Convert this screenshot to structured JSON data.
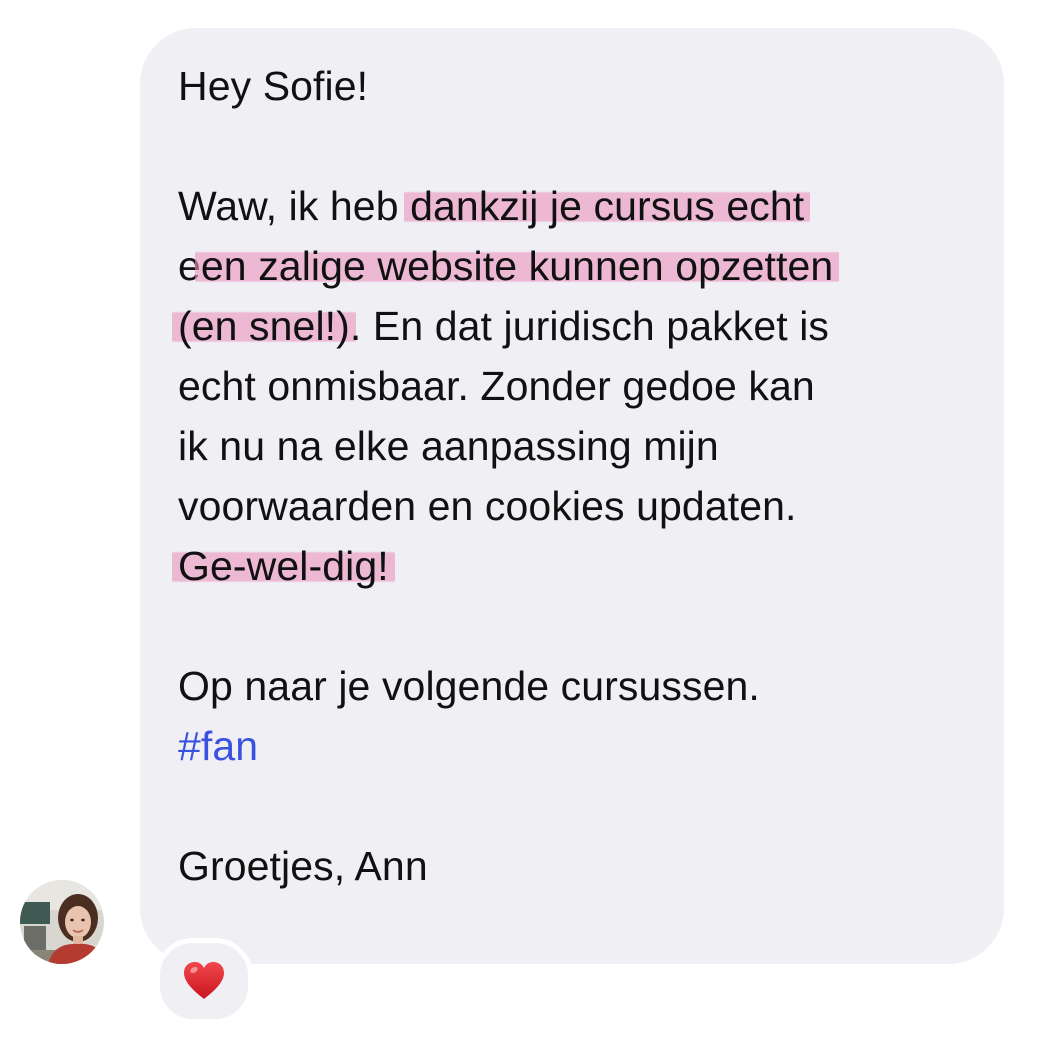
{
  "message": {
    "greeting": "Hey Sofie!",
    "p1_l1_pre": "Waw, ik heb ",
    "p1_l1_hl": "dankzij je cursus echt",
    "p1_l2_pre": "e",
    "p1_l2_hl": "en zalige website kunnen opzetten",
    "p1_l3_hl": "(en snel!)",
    "p1_l3_post": ". En dat juridisch pakket is",
    "p1_l4": "echt onmisbaar. Zonder gedoe kan",
    "p1_l5": "ik nu na elke aanpassing mijn",
    "p1_l6": "voorwaarden en cookies updaten.",
    "p1_l7_hl": "Ge-wel-dig!",
    "p2_l1": "Op naar je volgende cursussen.",
    "hashtag": "#fan",
    "signoff": "Groetjes, Ann"
  },
  "reaction": {
    "icon": "heart-icon",
    "color": "#e0242b"
  },
  "colors": {
    "bubble": "#efeff4",
    "highlight": "#ec96be",
    "hashtag": "#3a52e0"
  }
}
